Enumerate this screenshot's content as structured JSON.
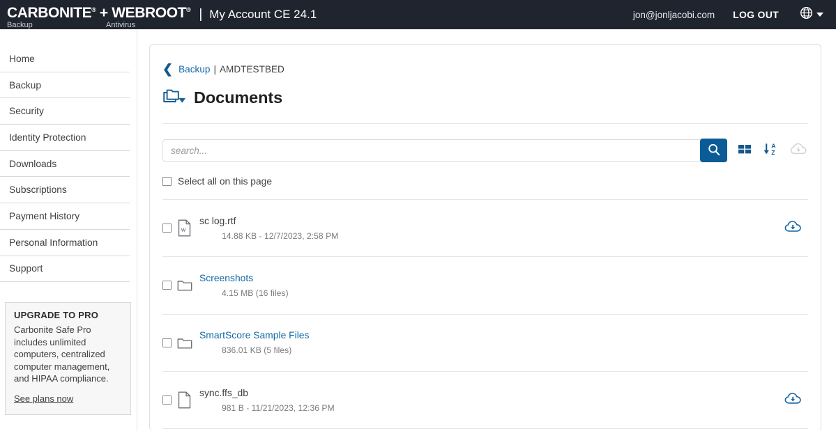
{
  "header": {
    "brand_line1_a": "CARBONITE",
    "brand_line1_plus": "+",
    "brand_line1_b": "WEBROOT",
    "brand_sub_a": "Backup",
    "brand_sub_b": "Antivirus",
    "divider": "|",
    "account_title": "My Account CE 24.1",
    "user_email": "jon@jonljacobi.com",
    "logout_label": "LOG OUT",
    "globe_icon": "globe-icon",
    "caret_icon": "chevron-down-icon",
    "bg_color": "#20242e"
  },
  "sidebar": {
    "items": [
      {
        "label": "Home"
      },
      {
        "label": "Backup"
      },
      {
        "label": "Security"
      },
      {
        "label": "Identity Protection"
      },
      {
        "label": "Downloads"
      },
      {
        "label": "Subscriptions"
      },
      {
        "label": "Payment History"
      },
      {
        "label": "Personal Information"
      },
      {
        "label": "Support"
      }
    ],
    "upgrade": {
      "title": "UPGRADE TO PRO",
      "body": "Carbonite Safe Pro includes unlimited computers, centralized computer management, and HIPAA compliance.",
      "link": "See plans now"
    }
  },
  "breadcrumb": {
    "back_icon": "chevron-left-icon",
    "parent": "Backup",
    "separator": "|",
    "current": "AMDTESTBED"
  },
  "page": {
    "folders_icon": "folders-dropdown-icon",
    "title": "Documents"
  },
  "toolbar": {
    "search_placeholder": "search...",
    "search_value": "",
    "search_icon": "search-icon",
    "grid_view_icon": "grid-view-icon",
    "sort_az_icon": "sort-alpha-down-icon",
    "download_all_icon": "cloud-download-icon",
    "download_all_enabled": false,
    "accent_color": "#0a5b96"
  },
  "list": {
    "select_all_label": "Select all on this page",
    "select_all_checked": false,
    "rows": [
      {
        "name": "sc log.rtf",
        "meta": "14.88 KB  -  12/7/2023, 2:58 PM",
        "type": "file",
        "icon": "word-document-icon",
        "icon_letter": "w",
        "is_link": false,
        "checked": false,
        "download_icon": "cloud-download-icon",
        "has_download": true
      },
      {
        "name": "Screenshots",
        "meta": "4.15 MB (16 files)",
        "type": "folder",
        "icon": "folder-icon",
        "icon_letter": "",
        "is_link": true,
        "checked": false,
        "download_icon": "",
        "has_download": false
      },
      {
        "name": "SmartScore Sample Files",
        "meta": "836.01 KB (5 files)",
        "type": "folder",
        "icon": "folder-icon",
        "icon_letter": "",
        "is_link": true,
        "checked": false,
        "download_icon": "",
        "has_download": false
      },
      {
        "name": "sync.ffs_db",
        "meta": "981 B  -  11/21/2023, 12:36 PM",
        "type": "file",
        "icon": "generic-document-icon",
        "icon_letter": "",
        "is_link": false,
        "checked": false,
        "download_icon": "cloud-download-icon",
        "has_download": true
      }
    ]
  }
}
